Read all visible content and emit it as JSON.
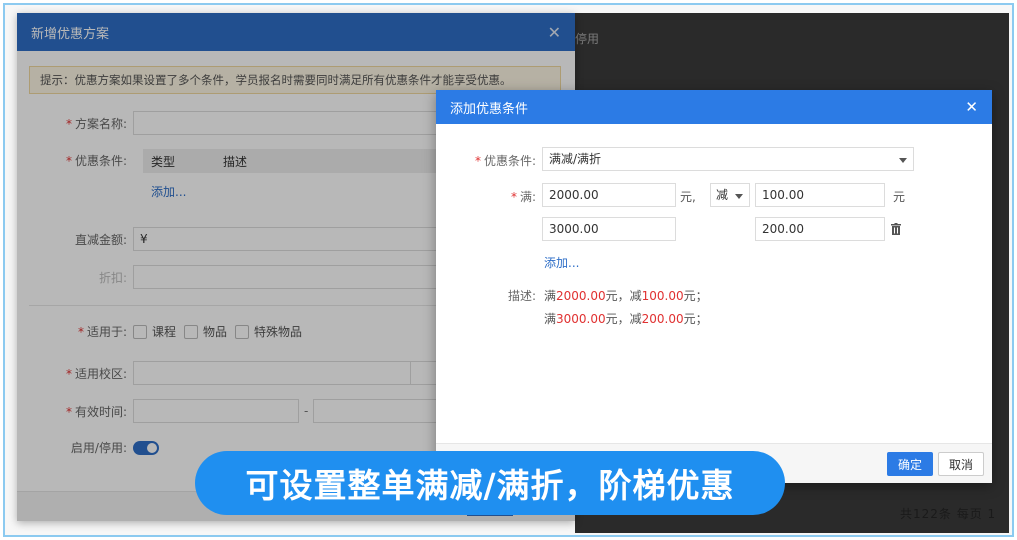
{
  "background": {
    "status_text": "停用",
    "pager_text": "共122条  每页  1"
  },
  "dialog_new_plan": {
    "title": "新增优惠方案",
    "tip": "提示：优惠方案如果设置了多个条件，学员报名时需要同时满足所有优惠条件才能享受优惠。",
    "fields": {
      "plan_name_label": "方案名称:",
      "conditions_label": "优惠条件:",
      "col_type": "类型",
      "col_desc": "描述",
      "add_link": "添加...",
      "direct_discount_label": "直减金额:",
      "currency": "¥",
      "discount_label": "折扣:",
      "applies_to_label": "适用于:",
      "opt_course": "课程",
      "opt_item": "物品",
      "opt_special_item": "特殊物品",
      "campus_label": "适用校区:",
      "valid_time_label": "有效时间:",
      "date_sep": "-",
      "enable_label": "启用/停用:"
    }
  },
  "dialog_add_condition": {
    "title": "添加优惠条件",
    "condition_label": "优惠条件:",
    "condition_value": "满减/满折",
    "full_label": "满:",
    "tiers": [
      {
        "threshold": "2000.00",
        "amount": "100.00"
      },
      {
        "threshold": "3000.00",
        "amount": "200.00"
      }
    ],
    "unit_yuan": "元",
    "unit_yuan_comma": "元,",
    "mode_value": "减",
    "add_link": "添加...",
    "desc_label": "描述:",
    "desc_lines": [
      {
        "p1": "满",
        "v1": "2000.00",
        "p2": "元，减",
        "v2": "100.00",
        "p3": "元；"
      },
      {
        "p1": "满",
        "v1": "3000.00",
        "p2": "元，减",
        "v2": "200.00",
        "p3": "元；"
      }
    ],
    "confirm_label": "确定",
    "cancel_label": "取消"
  },
  "banner": {
    "text": "可设置整单满减/满折，阶梯优惠"
  },
  "colors": {
    "primary": "#2c7be5",
    "banner": "#1f8ff0",
    "required": "#e03131",
    "border_frame": "#8ccaf0"
  }
}
